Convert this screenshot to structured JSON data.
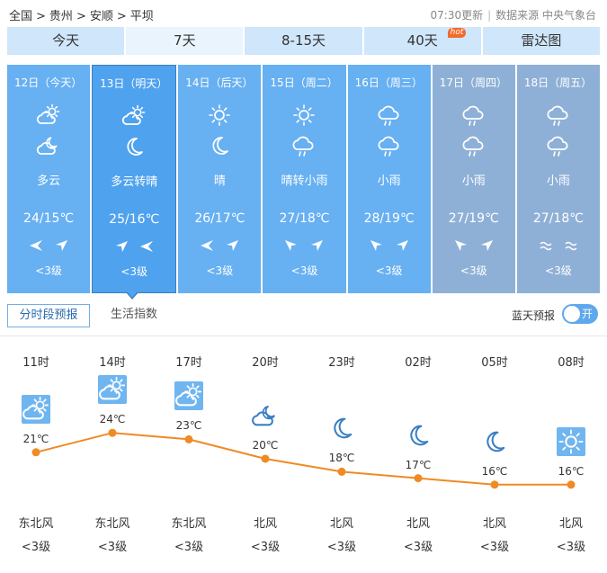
{
  "breadcrumb": [
    "全国",
    "贵州",
    "安顺",
    "平坝"
  ],
  "top_info": {
    "update": "07:30更新",
    "source": "数据来源 中央气象台"
  },
  "tabs": [
    {
      "label": "今天",
      "active": false
    },
    {
      "label": "7天",
      "active": true
    },
    {
      "label": "8-15天",
      "active": false
    },
    {
      "label": "40天",
      "active": false,
      "badge": "hot"
    },
    {
      "label": "雷达图",
      "active": false
    }
  ],
  "days": [
    {
      "date": "12日（今天）",
      "icon1": "partly-cloudy-day-icon",
      "icon2": "partly-cloudy-night-icon",
      "cond": "多云",
      "temp": "24/15℃",
      "wind1": "arrow-left-icon",
      "wind2": "arrow-upright-icon",
      "level": "<3级",
      "state": "normal"
    },
    {
      "date": "13日（明天）",
      "icon1": "partly-cloudy-day-icon",
      "icon2": "moon-icon",
      "cond": "多云转晴",
      "temp": "25/16℃",
      "wind1": "arrow-upright-icon",
      "wind2": "arrow-left-icon",
      "level": "<3级",
      "state": "selected"
    },
    {
      "date": "14日（后天）",
      "icon1": "sun-icon",
      "icon2": "moon-icon",
      "cond": "晴",
      "temp": "26/17℃",
      "wind1": "arrow-left-icon",
      "wind2": "arrow-upright-icon",
      "level": "<3级",
      "state": "normal"
    },
    {
      "date": "15日（周二）",
      "icon1": "sun-icon",
      "icon2": "rain-cloud-icon",
      "cond": "晴转小雨",
      "temp": "27/18℃",
      "wind1": "arrow-upleft-icon",
      "wind2": "arrow-upright-icon",
      "level": "<3级",
      "state": "normal"
    },
    {
      "date": "16日（周三）",
      "icon1": "rain-cloud-icon",
      "icon2": "rain-cloud-icon",
      "cond": "小雨",
      "temp": "28/19℃",
      "wind1": "arrow-upleft-icon",
      "wind2": "arrow-upright-icon",
      "level": "<3级",
      "state": "normal"
    },
    {
      "date": "17日（周四）",
      "icon1": "rain-cloud-icon",
      "icon2": "rain-cloud-icon",
      "cond": "小雨",
      "temp": "27/19℃",
      "wind1": "arrow-upleft-icon",
      "wind2": "arrow-upright-icon",
      "level": "<3级",
      "state": "past"
    },
    {
      "date": "18日（周五）",
      "icon1": "rain-cloud-icon",
      "icon2": "rain-cloud-icon",
      "cond": "小雨",
      "temp": "27/18℃",
      "wind1": "wave-icon",
      "wind2": "wave-icon",
      "level": "<3级",
      "state": "past"
    }
  ],
  "subtabs": {
    "hourly": "分时段预报",
    "life": "生活指数"
  },
  "bluesky": {
    "label": "蓝天预报",
    "toggle": "开"
  },
  "chart_data": {
    "type": "line",
    "x": [
      "11时",
      "14时",
      "17时",
      "20时",
      "23时",
      "02时",
      "05时",
      "08时"
    ],
    "values": [
      21,
      24,
      23,
      20,
      18,
      17,
      16,
      16
    ],
    "labels": [
      "21℃",
      "24℃",
      "23℃",
      "20℃",
      "18℃",
      "17℃",
      "16℃",
      "16℃"
    ],
    "icons": [
      "partly-cloudy-day-icon",
      "partly-cloudy-day-icon",
      "partly-cloudy-day-icon",
      "partly-cloudy-night-icon",
      "moon-icon",
      "moon-icon",
      "moon-icon",
      "sun-icon"
    ],
    "wind_dir": [
      "东北风",
      "东北风",
      "东北风",
      "北风",
      "北风",
      "北风",
      "北风",
      "北风"
    ],
    "wind_level": [
      "<3级",
      "<3级",
      "<3级",
      "<3级",
      "<3级",
      "<3级",
      "<3级",
      "<3级"
    ],
    "line_color": "#f08a24"
  },
  "colors": {
    "card": "#67b0f2",
    "card_selected": "#4fa2ee",
    "card_past": "#8fb0d6",
    "tab": "#cfe6fb"
  }
}
